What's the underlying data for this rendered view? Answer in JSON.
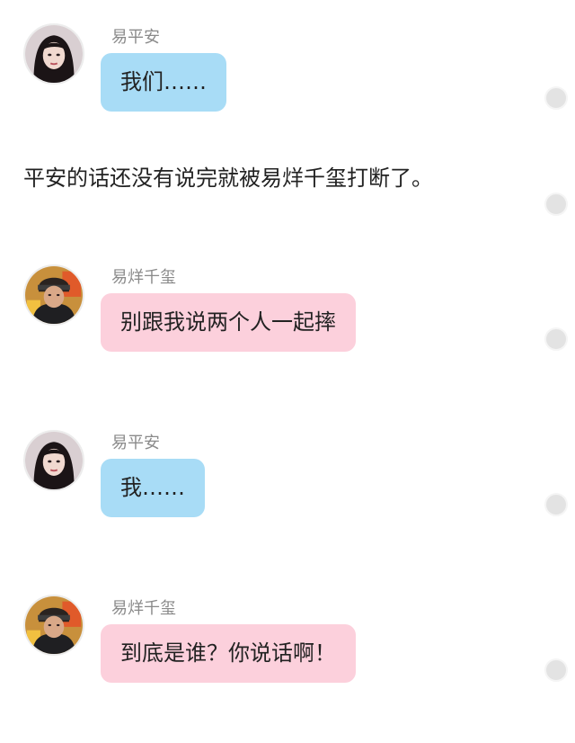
{
  "messages": [
    {
      "speaker": "易平安",
      "text": "我们……",
      "bubble_color": "#a8dcf6",
      "avatar": "female-avatar"
    },
    {
      "speaker": "易烊千玺",
      "text": "别跟我说两个人一起摔",
      "bubble_color": "#fcd0dc",
      "avatar": "male-avatar"
    },
    {
      "speaker": "易平安",
      "text": "我……",
      "bubble_color": "#a8dcf6",
      "avatar": "female-avatar"
    },
    {
      "speaker": "易烊千玺",
      "text": "到底是谁？你说话啊！",
      "bubble_color": "#fcd0dc",
      "avatar": "male-avatar"
    }
  ],
  "narration": "平安的话还没有说完就被易烊千玺打断了。",
  "side_dot_icon": "circle-dot-icon",
  "colors": {
    "blue_bubble": "#a8dcf6",
    "pink_bubble": "#fcd0dc",
    "name_text": "#8a8a8a",
    "body_text": "#222222"
  }
}
